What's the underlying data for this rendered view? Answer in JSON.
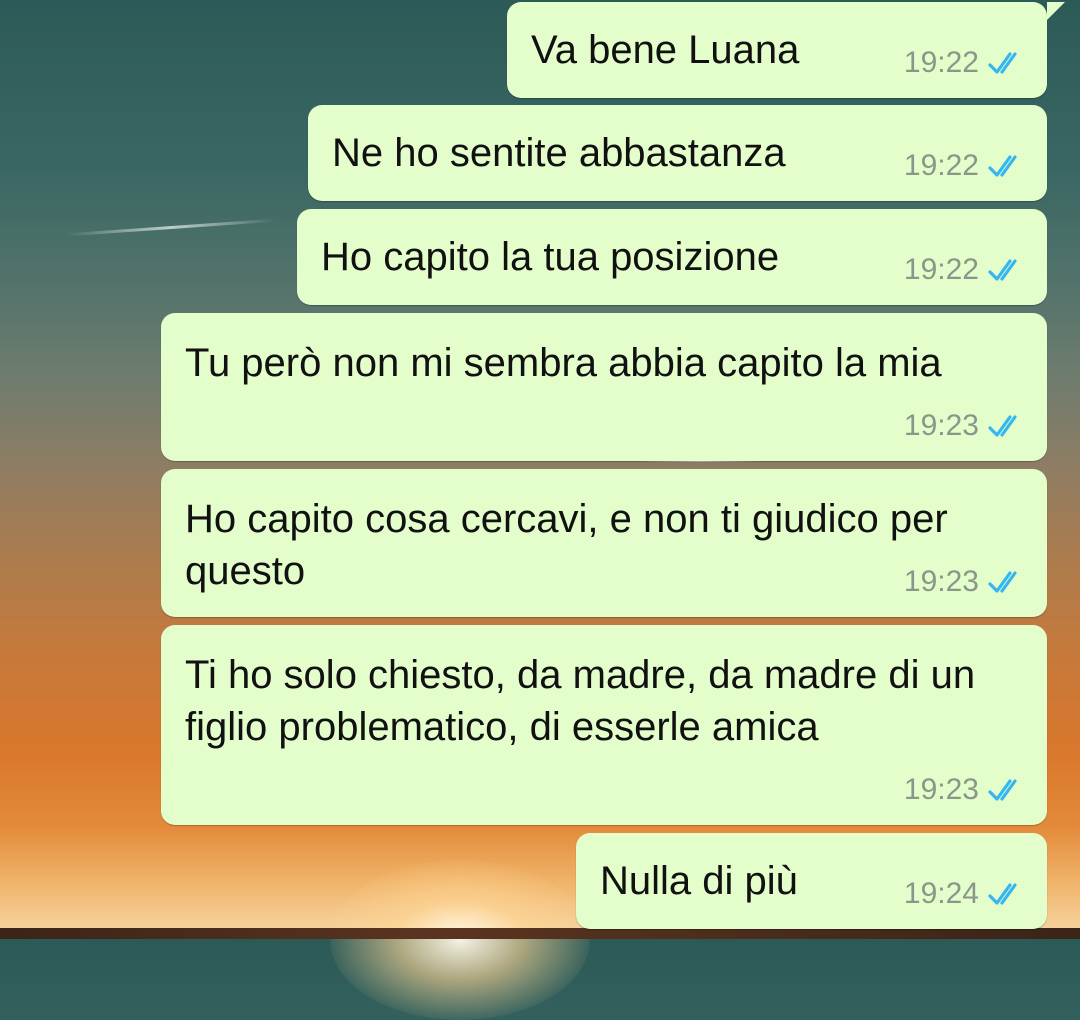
{
  "chat": {
    "messages": [
      {
        "text": "Va bene Luana",
        "time": "19:22",
        "status": "read"
      },
      {
        "text": "Ne ho sentite abbastanza",
        "time": "19:22",
        "status": "read"
      },
      {
        "text": "Ho capito la tua posizione",
        "time": "19:22",
        "status": "read"
      },
      {
        "text": "Tu però non mi sembra abbia capito la mia",
        "time": "19:23",
        "status": "read"
      },
      {
        "text": "Ho capito cosa cercavi, e non ti giudico per questo",
        "time": "19:23",
        "status": "read"
      },
      {
        "text": "Ti ho solo chiesto, da madre, da madre di un figlio problematico, di esserle amica",
        "time": "19:23",
        "status": "read"
      },
      {
        "text": "Nulla di più",
        "time": "19:24",
        "status": "read"
      }
    ],
    "colors": {
      "bubble": "#e3fdcb",
      "read_ticks": "#34b7f1",
      "time": "#8a9788"
    },
    "icons": {
      "read_receipt": "double-check-icon"
    }
  }
}
